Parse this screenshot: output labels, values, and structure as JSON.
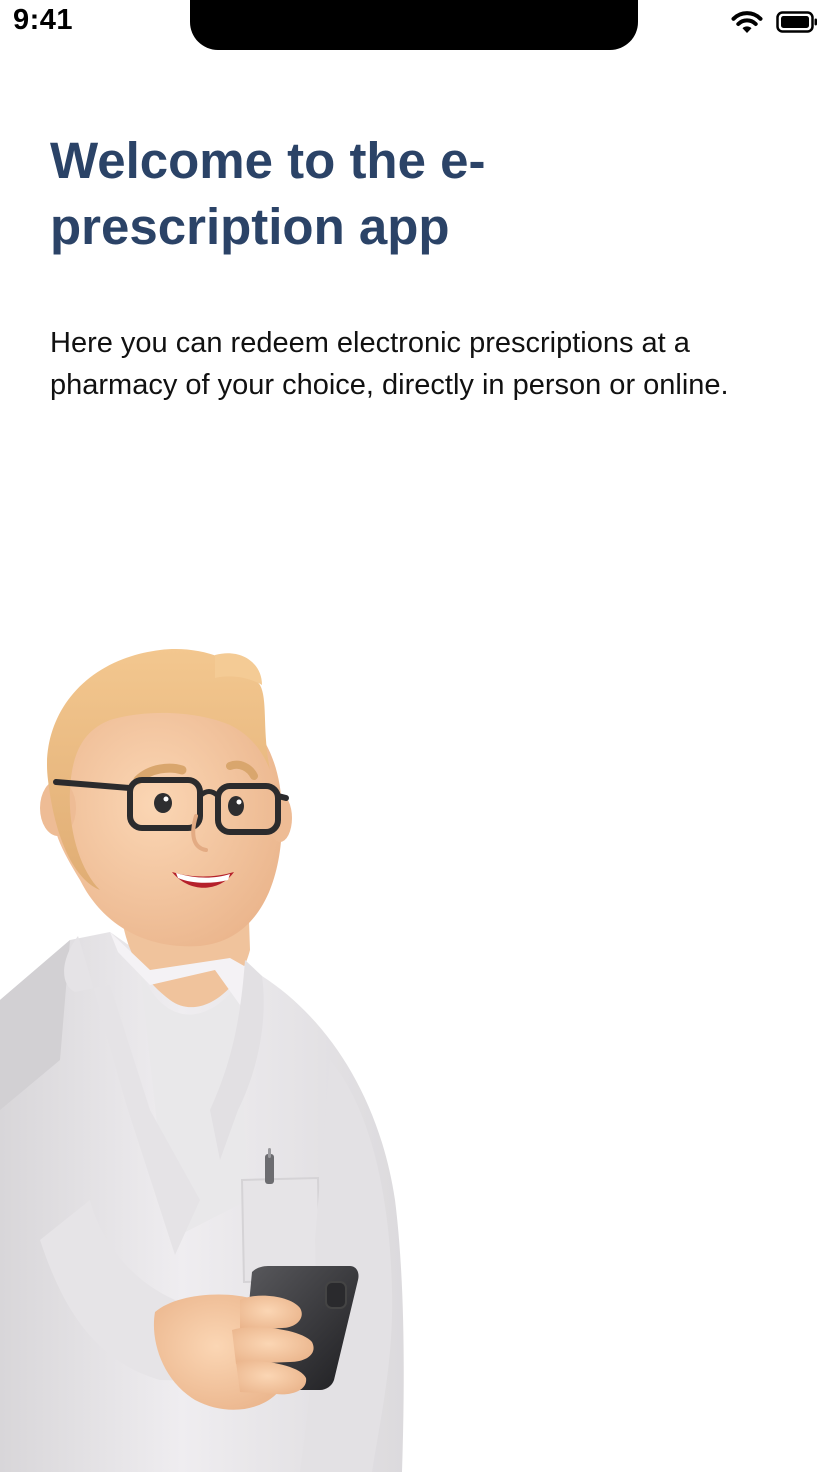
{
  "status_bar": {
    "time": "9:41",
    "icons": [
      "wifi-icon",
      "battery-icon"
    ]
  },
  "welcome": {
    "title": "Welcome to the e-prescription app",
    "description": "Here you can redeem electronic prescriptions at a pharmacy of your choice, directly in person or online."
  },
  "illustration": {
    "subject": "pharmacist-holding-phone"
  },
  "colors": {
    "title": "#2b4367",
    "body_text": "#111111",
    "background": "#ffffff"
  }
}
